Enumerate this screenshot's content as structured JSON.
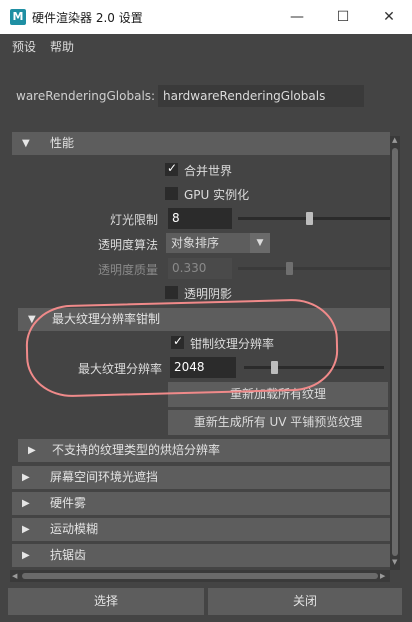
{
  "window": {
    "icon_letter": "M",
    "title": "硬件渲染器 2.0 设置",
    "minimize": "—",
    "maximize": "☐",
    "close": "✕"
  },
  "menu": [
    "预设",
    "帮助"
  ],
  "node": {
    "label": "wareRenderingGlobals:",
    "value": "hardwareRenderingGlobals"
  },
  "performance": {
    "header": "性能",
    "merge_world": {
      "label": "合并世界",
      "checked": true
    },
    "gpu_instancing": {
      "label": "GPU 实例化",
      "checked": false
    },
    "light_limit": {
      "label": "灯光限制",
      "value": "8",
      "slider": 0.47
    },
    "transparency_algorithm": {
      "label": "透明度算法",
      "value": "对象排序"
    },
    "transparency_quality": {
      "label": "透明度质量",
      "value": "0.330",
      "slider": 0.33
    },
    "transparent_shadows": {
      "label": "透明阴影",
      "checked": false
    }
  },
  "texture_clamp": {
    "header": "最大纹理分辨率钳制",
    "clamp_checkbox": {
      "label": "钳制纹理分辨率",
      "checked": true
    },
    "max_resolution": {
      "label": "最大纹理分辨率",
      "value": "2048",
      "slider": 0.2
    },
    "reload_button": "重新加载所有纹理",
    "regen_button": "重新生成所有 UV 平铺预览纹理"
  },
  "collapsed_sections": [
    "不支持的纹理类型的烘焙分辨率",
    "屏幕空间环境光遮挡",
    "硬件雾",
    "运动模糊",
    "抗锯齿"
  ],
  "footer": {
    "select_button": "选择",
    "close_button": "关闭"
  },
  "colors": {
    "accent_annotation": "#f08a8a",
    "panel": "#444444",
    "header": "#5d5d5d"
  }
}
